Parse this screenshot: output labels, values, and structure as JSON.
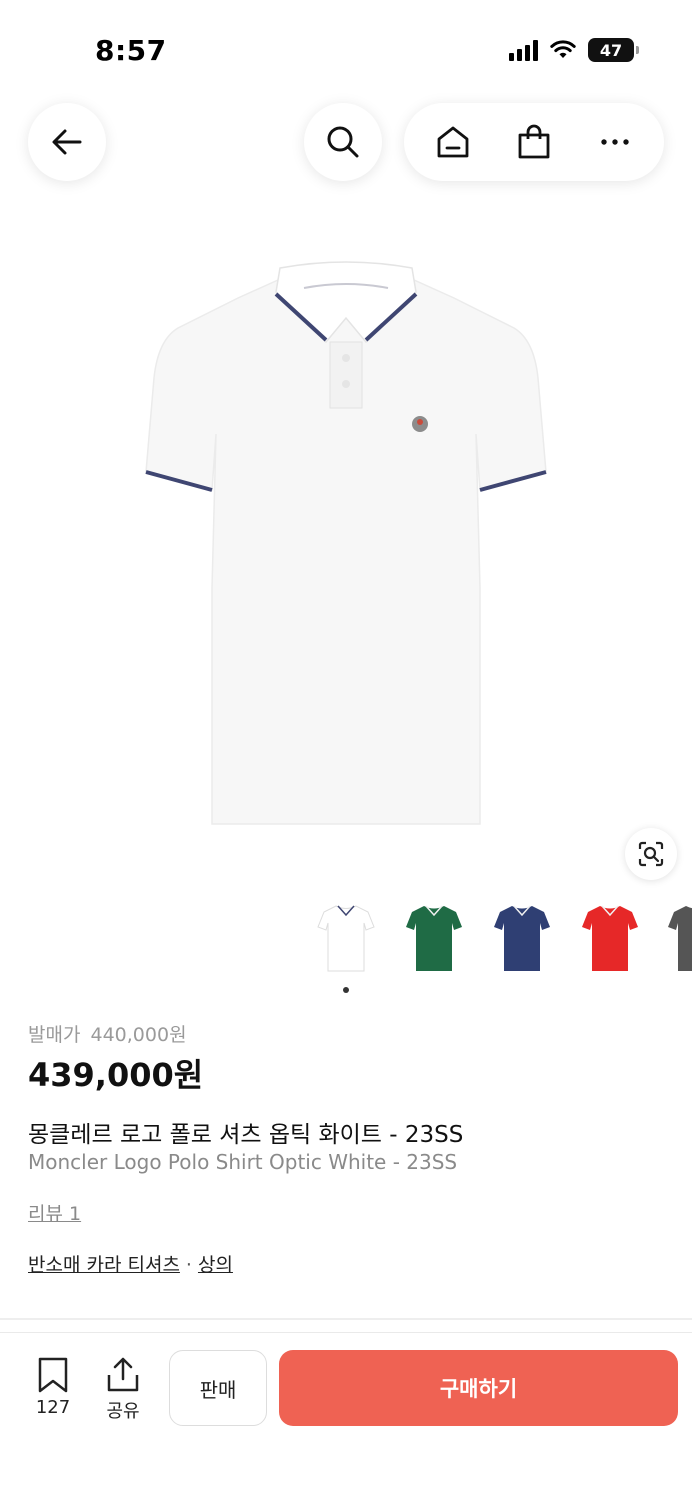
{
  "status": {
    "time": "8:57",
    "battery": "47"
  },
  "colors": {
    "accent": "#ef6253",
    "thumbs": [
      "#ffffff",
      "#1f6b45",
      "#2f3f73",
      "#e62828",
      "#555555"
    ]
  },
  "nav": {
    "icons": [
      "arrow-left-icon",
      "search-icon",
      "home-icon",
      "shopping-bag-icon",
      "more-icon"
    ]
  },
  "product": {
    "release_price_label": "발매가",
    "release_price": "440,000원",
    "price": "439,000원",
    "title_ko": "몽클레르 로고 폴로 셔츠 옵틱 화이트 - 23SS",
    "title_en": "Moncler Logo Polo Shirt Optic White - 23SS",
    "review": "리뷰 1",
    "category_1": "반소매 카라 티셔츠",
    "category_2": "상의"
  },
  "bottom": {
    "bookmark_count": "127",
    "share_label": "공유",
    "sell_label": "판매",
    "buy_label": "구매하기"
  }
}
